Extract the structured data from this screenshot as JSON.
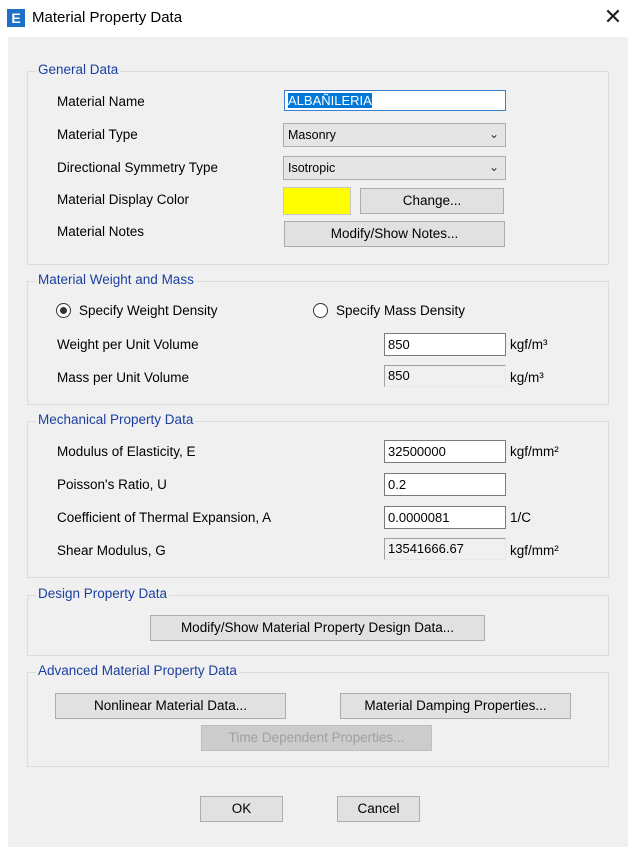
{
  "window": {
    "title": "Material Property Data",
    "icon_letter": "E",
    "close_glyph": "✕"
  },
  "general": {
    "title": "General Data",
    "material_name_label": "Material Name",
    "material_name_value": "ALBAÑILERIA",
    "material_type_label": "Material Type",
    "material_type_value": "Masonry",
    "symmetry_label": "Directional Symmetry Type",
    "symmetry_value": "Isotropic",
    "display_color_label": "Material Display Color",
    "display_color": "#ffff00",
    "change_label": "Change...",
    "notes_label": "Material Notes",
    "notes_button": "Modify/Show Notes..."
  },
  "weight": {
    "title": "Material Weight and Mass",
    "weight_density_option": "Specify Weight Density",
    "mass_density_option": "Specify Mass Density",
    "selected": "weight",
    "weight_label": "Weight per Unit Volume",
    "weight_value": "850",
    "weight_unit": "kgf/m³",
    "mass_label": "Mass per Unit Volume",
    "mass_value": "850",
    "mass_unit": "kg/m³"
  },
  "mechanical": {
    "title": "Mechanical Property Data",
    "e_label": "Modulus of Elasticity,  E",
    "e_value": "32500000",
    "e_unit": "kgf/mm²",
    "u_label": "Poisson's Ratio,  U",
    "u_value": "0.2",
    "a_label": "Coefficient of Thermal Expansion,  A",
    "a_value": "0.0000081",
    "a_unit": "1/C",
    "g_label": "Shear Modulus,  G",
    "g_value": "13541666.67",
    "g_unit": "kgf/mm²"
  },
  "design": {
    "title": "Design Property Data",
    "button": "Modify/Show Material Property Design Data..."
  },
  "advanced": {
    "title": "Advanced Material Property Data",
    "nonlinear_button": "Nonlinear Material Data...",
    "damping_button": "Material Damping Properties...",
    "time_dependent_button": "Time Dependent Properties..."
  },
  "footer": {
    "ok": "OK",
    "cancel": "Cancel"
  }
}
